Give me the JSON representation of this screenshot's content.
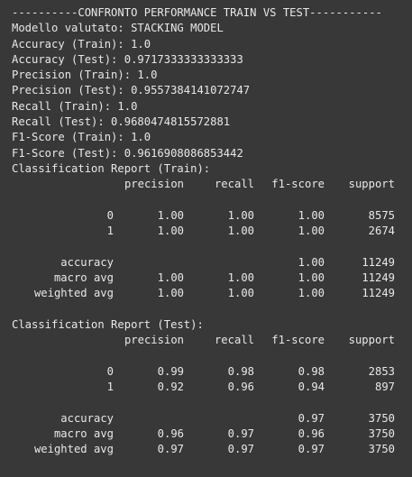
{
  "header": "----------CONFRONTO PERFORMANCE TRAIN VS TEST-----------",
  "metrics": [
    "Modello valutato: STACKING MODEL",
    "Accuracy (Train): 1.0",
    "Accuracy (Test): 0.9717333333333333",
    "Precision (Train): 1.0",
    "Precision (Test): 0.9557384141072747",
    "Recall (Train): 1.0",
    "Recall (Test): 0.9680474815572881",
    "F1-Score (Train): 1.0",
    "F1-Score (Test): 0.9616908086853442"
  ],
  "columns": [
    "precision",
    "recall",
    "f1-score",
    "support"
  ],
  "train_report": {
    "title": "Classification Report (Train):",
    "rows": [
      [
        "0",
        "1.00",
        "1.00",
        "1.00",
        "8575"
      ],
      [
        "1",
        "1.00",
        "1.00",
        "1.00",
        "2674"
      ]
    ],
    "summary": [
      [
        "accuracy",
        "",
        "",
        "1.00",
        "11249"
      ],
      [
        "macro avg",
        "1.00",
        "1.00",
        "1.00",
        "11249"
      ],
      [
        "weighted avg",
        "1.00",
        "1.00",
        "1.00",
        "11249"
      ]
    ]
  },
  "test_report": {
    "title": "Classification Report (Test):",
    "rows": [
      [
        "0",
        "0.99",
        "0.98",
        "0.98",
        "2853"
      ],
      [
        "1",
        "0.92",
        "0.96",
        "0.94",
        "897"
      ]
    ],
    "summary": [
      [
        "accuracy",
        "",
        "",
        "0.97",
        "3750"
      ],
      [
        "macro avg",
        "0.96",
        "0.97",
        "0.96",
        "3750"
      ],
      [
        "weighted avg",
        "0.97",
        "0.97",
        "0.97",
        "3750"
      ]
    ]
  }
}
